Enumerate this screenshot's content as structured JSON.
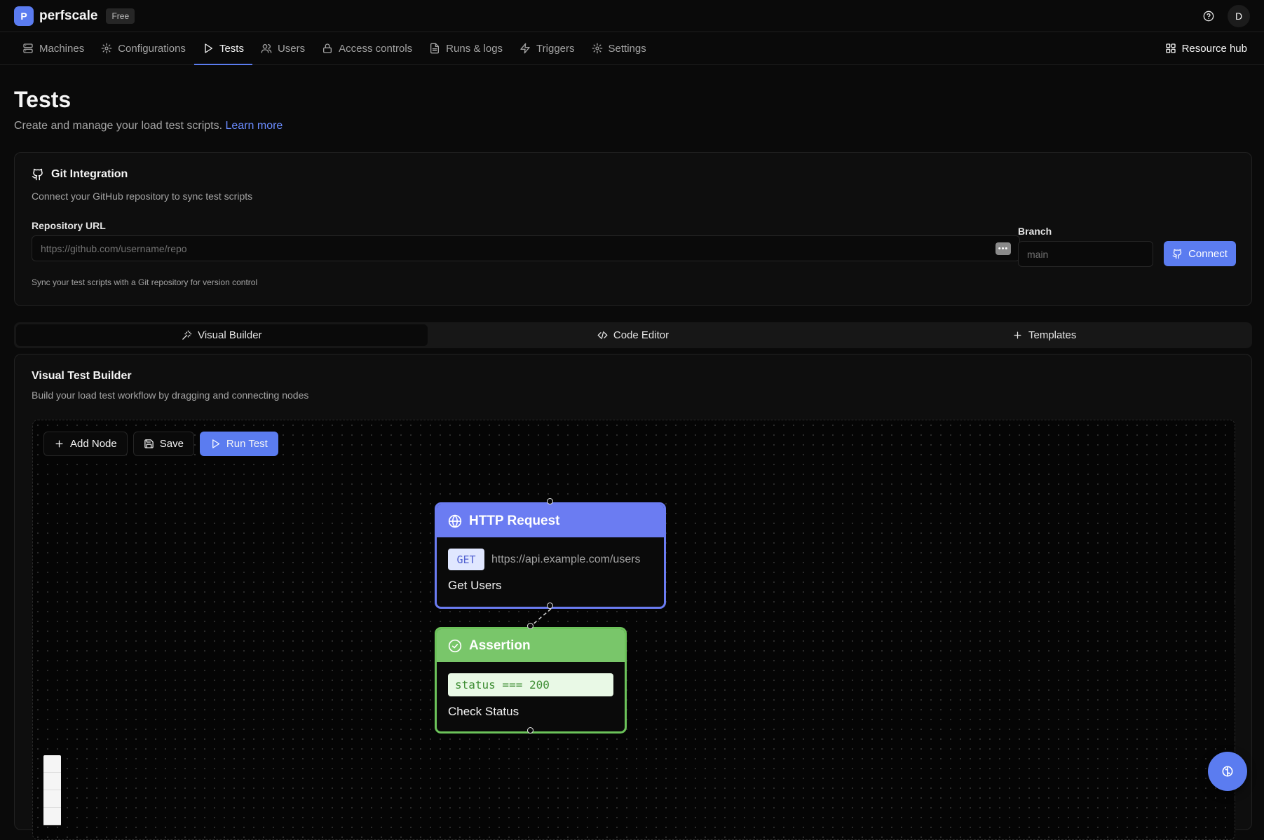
{
  "app": {
    "logo_letter": "P",
    "name": "perfscale",
    "plan": "Free",
    "avatar_initial": "D"
  },
  "nav": {
    "items": [
      {
        "label": "Machines",
        "icon": "server-icon"
      },
      {
        "label": "Configurations",
        "icon": "gear-icon"
      },
      {
        "label": "Tests",
        "icon": "play-icon",
        "active": true
      },
      {
        "label": "Users",
        "icon": "users-icon"
      },
      {
        "label": "Access controls",
        "icon": "lock-icon"
      },
      {
        "label": "Runs & logs",
        "icon": "document-icon"
      },
      {
        "label": "Triggers",
        "icon": "bolt-icon"
      },
      {
        "label": "Settings",
        "icon": "gear-icon"
      }
    ],
    "resource_hub": "Resource hub"
  },
  "page": {
    "title": "Tests",
    "subtitle": "Create and manage your load test scripts.",
    "learn_more": "Learn more"
  },
  "git": {
    "title": "Git Integration",
    "description": "Connect your GitHub repository to sync test scripts",
    "repo_label": "Repository URL",
    "repo_placeholder": "https://github.com/username/repo",
    "branch_label": "Branch",
    "branch_placeholder": "main",
    "connect_label": "Connect",
    "note": "Sync your test scripts with a Git repository for version control"
  },
  "tabs": [
    {
      "label": "Visual Builder",
      "icon": "magic-wand-icon",
      "active": true
    },
    {
      "label": "Code Editor",
      "icon": "code-icon"
    },
    {
      "label": "Templates",
      "icon": "plus-icon"
    }
  ],
  "builder": {
    "title": "Visual Test Builder",
    "description": "Build your load test workflow by dragging and connecting nodes",
    "toolbar": {
      "add_node": "Add Node",
      "save": "Save",
      "run_test": "Run Test"
    },
    "nodes": {
      "http": {
        "type_label": "HTTP Request",
        "method": "GET",
        "url": "https://api.example.com/users",
        "name": "Get Users"
      },
      "assertion": {
        "type_label": "Assertion",
        "expression": "status === 200",
        "name": "Check Status"
      }
    }
  },
  "colors": {
    "accent": "#5b7cf0",
    "http_node": "#6b7cf2",
    "assertion_node": "#79c66a",
    "background": "#0a0a0a"
  }
}
